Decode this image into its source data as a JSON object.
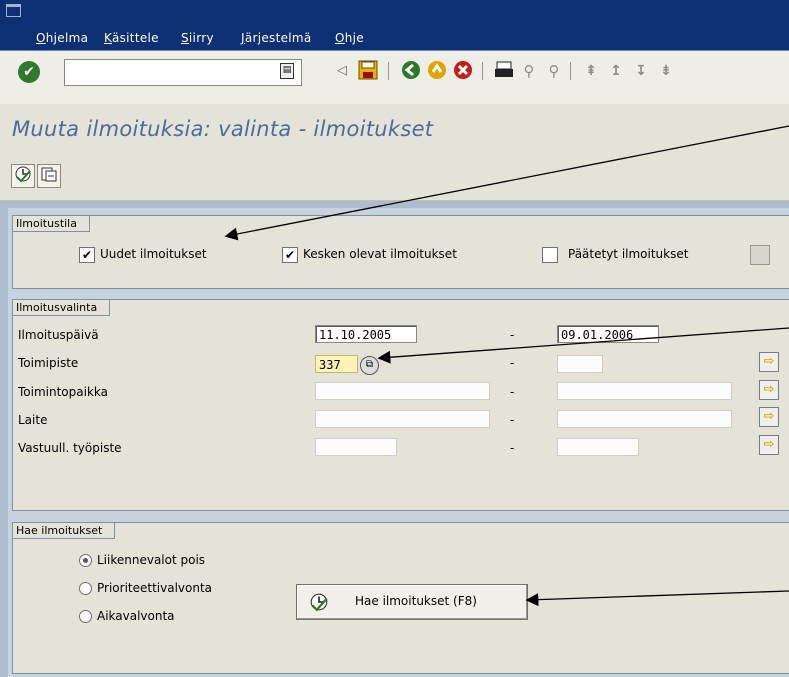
{
  "menu": {
    "items": [
      "Ohjelma",
      "Käsittele",
      "Siirry",
      "Järjestelmä",
      "Ohje"
    ]
  },
  "toolbar": {
    "command_field_value": "",
    "icons": [
      "enter-check-icon",
      "command-history-icon",
      "back-triangle-icon",
      "save-icon",
      "back-icon",
      "exit-icon",
      "cancel-icon",
      "print-icon",
      "find-icon",
      "find-next-icon",
      "first-page-icon",
      "previous-page-icon",
      "next-page-icon",
      "last-page-icon"
    ]
  },
  "page": {
    "title": "Muuta ilmoituksia: valinta - ilmoitukset"
  },
  "app_toolbar": {
    "icons": [
      "execute-clock-icon",
      "get-variant-icon"
    ]
  },
  "ilmoitustila": {
    "title": "Ilmoitustila",
    "options": [
      {
        "label": "Uudet ilmoitukset",
        "checked": true
      },
      {
        "label": "Kesken olevat ilmoitukset",
        "checked": true
      },
      {
        "label": "Päätetyt ilmoitukset",
        "checked": false
      }
    ]
  },
  "ilmoitusvalinta": {
    "title": "Ilmoitusvalinta",
    "range_separator": "-",
    "rows": [
      {
        "label": "Ilmoituspäivä",
        "from": "11.10.2005",
        "to": "09.01.2006"
      },
      {
        "label": "Toimipiste",
        "from": "337",
        "to": ""
      },
      {
        "label": "Toimintopaikka",
        "from": "",
        "to": ""
      },
      {
        "label": "Laite",
        "from": "",
        "to": ""
      },
      {
        "label": "Vastuull. työpiste",
        "from": "",
        "to": ""
      }
    ]
  },
  "hae": {
    "title": "Hae ilmoitukset",
    "radios": [
      {
        "label": "Liikennevalot pois",
        "selected": true
      },
      {
        "label": "Prioriteettivalvonta",
        "selected": false
      },
      {
        "label": "Aikavalvonta",
        "selected": false
      }
    ],
    "button_label": "Hae ilmoitukset (F8)"
  },
  "colors": {
    "menubar": "#0d2f73",
    "title_text": "#4a6aa0",
    "panel": "#e5e3d7",
    "focus_field": "#fff4b8"
  }
}
